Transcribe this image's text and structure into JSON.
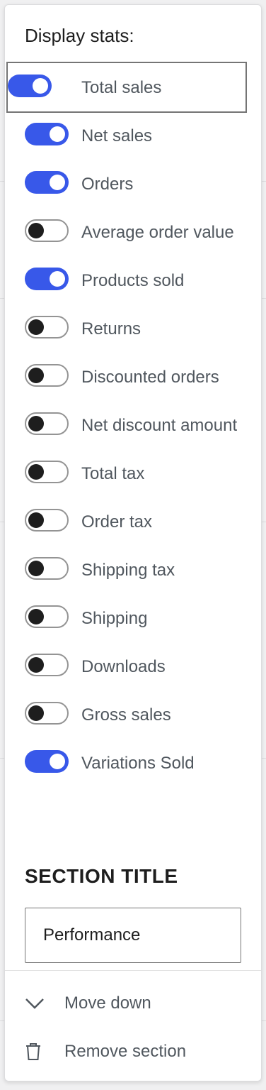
{
  "popover": {
    "title": "Display stats:",
    "stats": [
      {
        "label": "Total sales",
        "enabled": true
      },
      {
        "label": "Net sales",
        "enabled": true
      },
      {
        "label": "Orders",
        "enabled": true
      },
      {
        "label": "Average order value",
        "enabled": false
      },
      {
        "label": "Products sold",
        "enabled": true
      },
      {
        "label": "Returns",
        "enabled": false
      },
      {
        "label": "Discounted orders",
        "enabled": false
      },
      {
        "label": "Net discount amount",
        "enabled": false
      },
      {
        "label": "Total tax",
        "enabled": false
      },
      {
        "label": "Order tax",
        "enabled": false
      },
      {
        "label": "Shipping tax",
        "enabled": false
      },
      {
        "label": "Shipping",
        "enabled": false
      },
      {
        "label": "Downloads",
        "enabled": false
      },
      {
        "label": "Gross sales",
        "enabled": false
      },
      {
        "label": "Variations Sold",
        "enabled": true
      }
    ],
    "section_title_label": "SECTION TITLE",
    "section_title_value": "Performance",
    "actions": {
      "move_down": "Move down",
      "remove_section": "Remove section"
    }
  },
  "colors": {
    "toggle_on": "#3858e9",
    "toggle_off_knob": "#1e1e1e",
    "text_muted": "#50575e"
  },
  "icons": {
    "move_down": "chevron-down-icon",
    "remove_section": "trash-icon"
  }
}
